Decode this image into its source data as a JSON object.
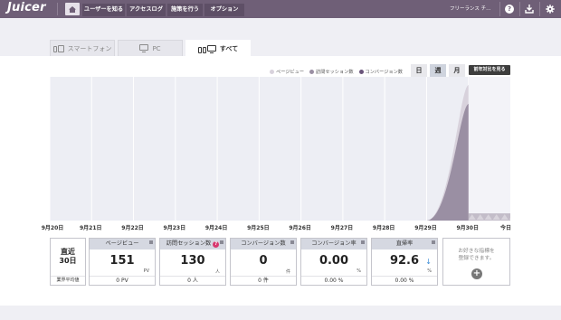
{
  "app": {
    "logo": "Juicer"
  },
  "nav": {
    "items": [
      {
        "label": "ユーザーを知る"
      },
      {
        "label": "アクセスログ"
      },
      {
        "label": "施策を行う"
      },
      {
        "label": "オプション"
      }
    ],
    "account_label": "フリーランス チ…",
    "icons": [
      "home-icon",
      "help-icon",
      "download-icon",
      "gear-icon"
    ]
  },
  "device_tabs": [
    {
      "label": "スマートフォン",
      "icon": "smartphone-icon",
      "selected": false
    },
    {
      "label": "PC",
      "icon": "monitor-icon",
      "selected": false
    },
    {
      "label": "すべて",
      "icon": "all-devices-icon",
      "selected": true
    }
  ],
  "legend": [
    {
      "label": "ページビュー",
      "color": "#d8d2dc"
    },
    {
      "label": "訪問セッション数",
      "color": "#9a8fa3"
    },
    {
      "label": "コンバージョン数",
      "color": "#6a557a"
    }
  ],
  "period_buttons": [
    {
      "label": "日",
      "selected": false
    },
    {
      "label": "週",
      "selected": true
    },
    {
      "label": "月",
      "selected": false
    }
  ],
  "yoy_button": "前年対比を見る",
  "chart_data": {
    "type": "area",
    "categories": [
      "9月20日",
      "9月21日",
      "9月22日",
      "9月23日",
      "9月24日",
      "9月25日",
      "9月26日",
      "9月27日",
      "9月28日",
      "9月29日",
      "9月30日",
      "今日"
    ],
    "series": [
      {
        "name": "ページビュー",
        "color": "#d8d2dc",
        "values": [
          0,
          0,
          0,
          0,
          0,
          0,
          0,
          0,
          0,
          0,
          151,
          0
        ]
      },
      {
        "name": "訪問セッション数",
        "color": "#9a8fa3",
        "values": [
          0,
          0,
          0,
          0,
          0,
          0,
          0,
          0,
          0,
          0,
          130,
          0
        ]
      }
    ],
    "ylim": [
      0,
      160
    ],
    "grid": true,
    "legend_position": "top-right",
    "shading": "lighter band after 9月30日"
  },
  "metrics": {
    "period": {
      "line1": "直近",
      "line2": "30日",
      "foot": "業界平均値"
    },
    "cards": [
      {
        "title": "ページビュー",
        "value": "151",
        "unit": "PV",
        "foot": "0 PV",
        "help": false,
        "arrow": ""
      },
      {
        "title": "訪問セッション数",
        "value": "130",
        "unit": "人",
        "foot": "0 人",
        "help": true,
        "arrow": ""
      },
      {
        "title": "コンバージョン数",
        "value": "0",
        "unit": "件",
        "foot": "0 件",
        "help": false,
        "arrow": ""
      },
      {
        "title": "コンバージョン率",
        "value": "0.00",
        "unit": "%",
        "foot": "0.00 %",
        "help": false,
        "arrow": ""
      },
      {
        "title": "直帰率",
        "value": "92.6",
        "unit": "%",
        "foot": "0.00 %",
        "help": false,
        "arrow": "↓"
      }
    ],
    "add_card": {
      "text": "お好きな指標を\n登録できます。",
      "icon": "plus-circle-icon"
    }
  }
}
